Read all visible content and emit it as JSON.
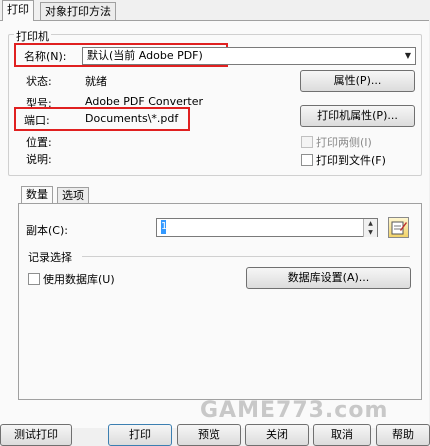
{
  "tabs": [
    {
      "label": "打印"
    },
    {
      "label": "对象打印方法"
    }
  ],
  "printer": {
    "group_title": "打印机",
    "name_label": "名称(N):",
    "name_value": "默认(当前 Adobe PDF)",
    "status_label": "状态:",
    "status_value": "就绪",
    "type_label": "型号:",
    "type_value": "Adobe PDF Converter",
    "port_label": "端口:",
    "port_value": "Documents\\*.pdf",
    "where_label": "位置:",
    "comment_label": "说明:",
    "properties_btn": "属性(P)...",
    "printer_properties_btn": "打印机属性(P)...",
    "duplex_label": "打印两侧(I)",
    "print_to_file_label": "打印到文件(F)"
  },
  "inner_tabs": [
    {
      "label": "数量"
    },
    {
      "label": "选项"
    }
  ],
  "quantity": {
    "copies_label": "副本(C):",
    "copies_value": "1",
    "records_title": "记录选择",
    "use_db_label": "使用数据库(U)",
    "db_settings_btn": "数据库设置(A)..."
  },
  "buttons": {
    "test": "测试打印",
    "print": "打印",
    "preview": "预览",
    "close": "关闭",
    "cancel": "取消",
    "help": "帮助"
  },
  "watermark": {
    "text": "GAME773.com",
    "accent": "#f5a623"
  },
  "colors": {
    "highlight": "#e02020",
    "selection": "#3399ff"
  }
}
